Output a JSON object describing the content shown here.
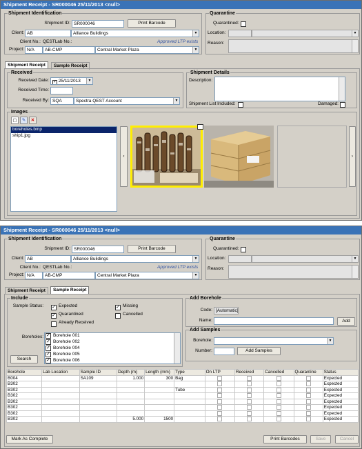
{
  "win1": {
    "title": "Shipment Receipt - SR000046 25/11/2013 <null>",
    "ident": {
      "group_label": "Shipment Identification",
      "shipment_id_label": "Shipment ID:",
      "shipment_id": "SR000046",
      "print_barcode": "Print Barcode",
      "client_label": "Client:",
      "client_code": "AB",
      "client_name": "Alliance Buildings",
      "approved_ltp": "Approved LTP exists",
      "client_no_label": "Client No.:",
      "qestlab_no_label": "QESTLab No.:",
      "project_label": "Project:",
      "project_code": "N/A",
      "project_lab_code": "AB-CMP",
      "project_name": "Central Market Plaza"
    },
    "quarantine": {
      "group_label": "Quarantine",
      "quarantined_label": "Quarantined:",
      "location_label": "Location:",
      "reason_label": "Reason:"
    },
    "tabs": [
      "Shipment Receipt",
      "Sample Receipt"
    ],
    "received": {
      "group_label": "Received",
      "date_label": "Received Date:",
      "date": "25/11/2013",
      "time_label": "Received Time:",
      "by_label": "Received By:",
      "by_code": "SQA",
      "by_name": "Spectra QEST Account"
    },
    "details": {
      "group_label": "Shipment Details",
      "description_label": "Description:",
      "list_included_label": "Shipment List Included:",
      "damaged_label": "Damaged:"
    },
    "images": {
      "group_label": "Images",
      "files": [
        "boreholes.bmp",
        "ship1.jpg"
      ]
    }
  },
  "win2": {
    "title": "Shipment Receipt - SR000046 25/11/2013 <null>",
    "include": {
      "group_label": "Include",
      "status_label": "Sample Status:",
      "expected": "Expected",
      "missing": "Missing",
      "quarantined": "Quarantined",
      "cancelled": "Cancelled",
      "already_received": "Already Received",
      "boreholes_label": "Boreholes:",
      "boreholes": [
        "Borehole 001",
        "Borehole 002",
        "Borehole 004",
        "Borehole 005",
        "Borehole 006"
      ],
      "search": "Search"
    },
    "add_borehole": {
      "group_label": "Add Borehole",
      "code_label": "Code:",
      "code": "[Automatic]",
      "name_label": "Name:",
      "add": "Add"
    },
    "add_samples": {
      "group_label": "Add Samples",
      "borehole_label": "Borehole:",
      "number_label": "Number:",
      "add_samples": "Add Samples"
    },
    "table": {
      "headers": [
        "Borehole",
        "Lab Location",
        "Sample ID",
        "Depth (m)",
        "Length (mm)",
        "Type",
        "On LTP",
        "Received",
        "Cancelled",
        "Quarantine",
        "Status"
      ],
      "rows": [
        {
          "borehole": "B004",
          "lab": "",
          "sample": "SA109",
          "depth": "1.000",
          "length": "300",
          "type": "Bag",
          "status": "Expected"
        },
        {
          "borehole": "B302",
          "lab": "",
          "sample": "",
          "depth": "",
          "length": "",
          "type": "",
          "status": "Expected"
        },
        {
          "borehole": "B302",
          "lab": "",
          "sample": "",
          "depth": "",
          "length": "",
          "type": "Tube",
          "status": "Expected"
        },
        {
          "borehole": "B302",
          "lab": "",
          "sample": "",
          "depth": "",
          "length": "",
          "type": "",
          "status": "Expected"
        },
        {
          "borehole": "B302",
          "lab": "",
          "sample": "",
          "depth": "",
          "length": "",
          "type": "",
          "status": "Expected"
        },
        {
          "borehole": "B302",
          "lab": "",
          "sample": "",
          "depth": "",
          "length": "",
          "type": "",
          "status": "Expected"
        },
        {
          "borehole": "B302",
          "lab": "",
          "sample": "",
          "depth": "",
          "length": "",
          "type": "",
          "status": "Expected"
        },
        {
          "borehole": "B302",
          "lab": "",
          "sample": "",
          "depth": "5.000",
          "length": "1500",
          "type": "",
          "status": "Expected"
        }
      ]
    },
    "mark_complete": "Mark As Complete",
    "print_barcodes": "Print Barcodes",
    "save": "Save",
    "cancel": "Cancel"
  }
}
